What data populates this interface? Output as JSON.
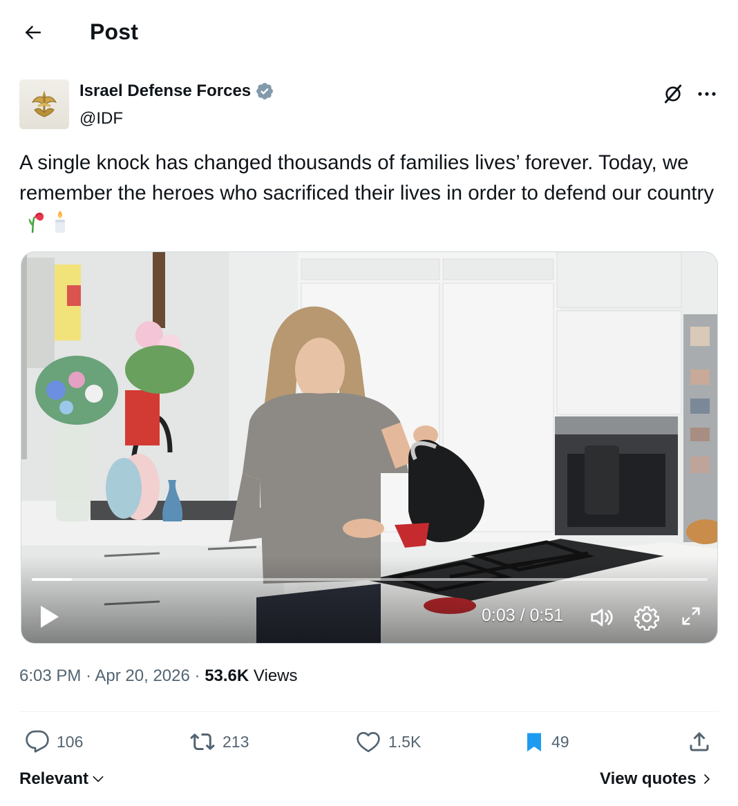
{
  "header": {
    "title": "Post",
    "back_icon": "arrow-left-icon"
  },
  "author": {
    "name": "Israel Defense Forces",
    "handle": "@IDF",
    "verified_icon": "verified-badge-icon",
    "verified_color": "#829aab"
  },
  "post": {
    "text": "A single knock has changed thousands of families lives’ forever. Today, we remember the heroes who sacrificed their lives in order to defend our country",
    "emojis": [
      "wilted-flower-icon",
      "candle-icon"
    ]
  },
  "video": {
    "current_time": "0:03",
    "duration": "0:51",
    "time_display": "0:03 / 0:51",
    "progress_fraction": 0.059
  },
  "meta": {
    "time": "6:03 PM",
    "separator": "·",
    "date": "Apr 20, 2026",
    "views_count": "53.6K",
    "views_label": "Views"
  },
  "actions": {
    "replies": "106",
    "reposts": "213",
    "likes": "1.5K",
    "bookmarks": "49"
  },
  "footer": {
    "sort_label": "Relevant",
    "view_quotes_label": "View quotes"
  },
  "colors": {
    "text_primary": "#0f1419",
    "text_secondary": "#536471",
    "bookmark_active": "#1d9bf0",
    "divider": "#eff3f4"
  }
}
